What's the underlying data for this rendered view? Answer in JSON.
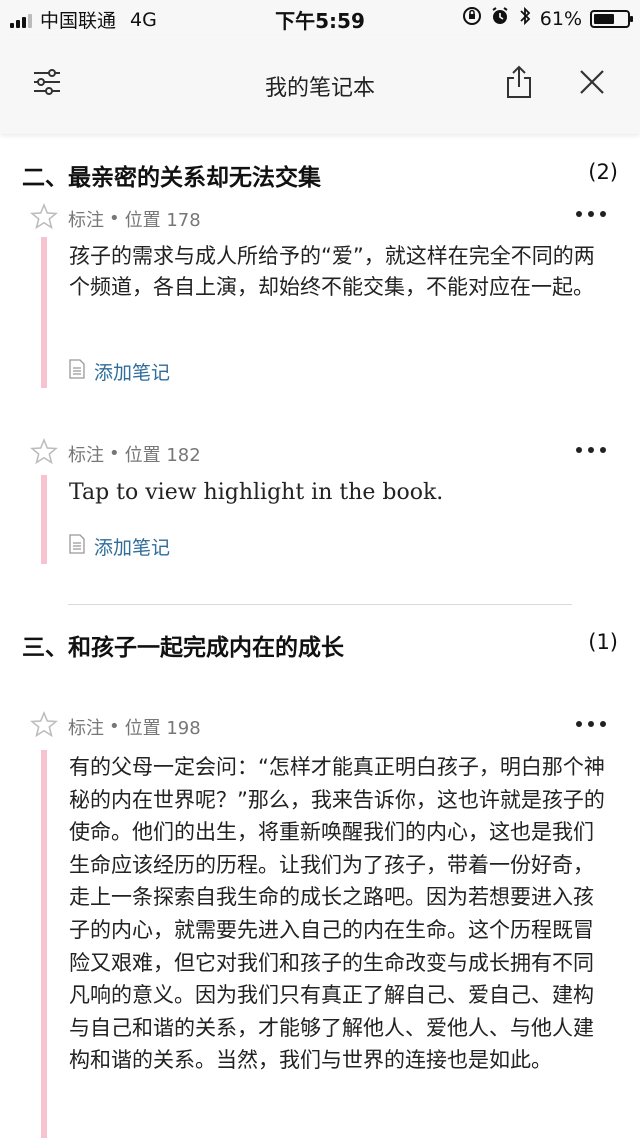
{
  "status_bar": {
    "carrier": "中国联通",
    "network": "4G",
    "time": "下午5:59",
    "battery_percent": "61%",
    "battery_level": 0.61
  },
  "header": {
    "title": "我的笔记本",
    "filter_icon": "sliders-icon",
    "share_icon": "share-icon",
    "close_icon": "close-icon"
  },
  "sections": [
    {
      "title": "二、最亲密的关系却无法交集",
      "count": "(2)",
      "items": [
        {
          "type_label": "标注",
          "separator": "•",
          "location": "位置 178",
          "text": "孩子的需求与成人所给予的“爱”，就这样在完全不同的两个频道，各自上演，却始终不能交集，不能对应在一起。",
          "add_note": "添加笔记"
        },
        {
          "type_label": "标注",
          "separator": "•",
          "location": "位置 182",
          "text": "Tap to view highlight in the book.",
          "add_note": "添加笔记"
        }
      ]
    },
    {
      "title": "三、和孩子一起完成内在的成长",
      "count": "(1)",
      "items": [
        {
          "type_label": "标注",
          "separator": "•",
          "location": "位置 198",
          "text": "有的父母一定会问：“怎样才能真正明白孩子，明白那个神秘的内在世界呢？”那么，我来告诉你，这也许就是孩子的使命。他们的出生，将重新唤醒我们的内心，这也是我们生命应该经历的历程。让我们为了孩子，带着一份好奇，走上一条探索自我生命的成长之路吧。因为若想要进入孩子的内心，就需要先进入自己的内在生命。这个历程既冒险又艰难，但它对我们和孩子的生命改变与成长拥有不同凡响的意义。因为我们只有真正了解自己、爱自己、建构与自己和谐的关系，才能够了解他人、爱他人、与他人建构和谐的关系。当然，我们与世界的连接也是如此。"
        }
      ]
    }
  ],
  "colors": {
    "highlight_bar": "#f6c3cf",
    "link": "#2f6d9b",
    "header_bg": "#f7f7f7"
  }
}
